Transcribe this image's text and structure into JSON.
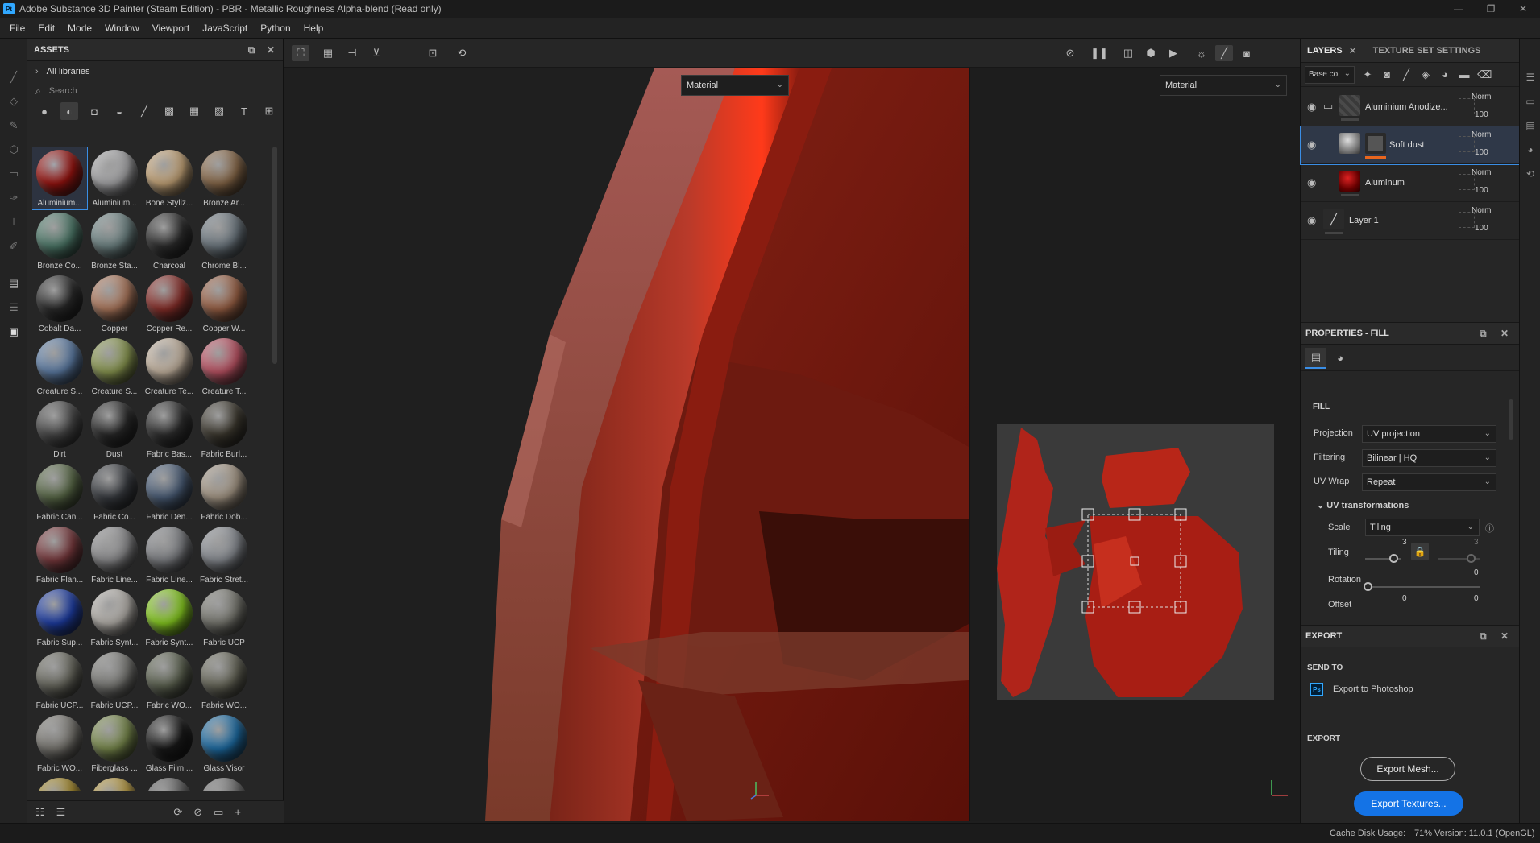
{
  "window": {
    "app_icon": "Pt",
    "title": "Adobe Substance 3D Painter (Steam Edition) - PBR - Metallic Roughness Alpha-blend (Read only)",
    "controls": [
      "—",
      "❐",
      "✕"
    ]
  },
  "menu": [
    "File",
    "Edit",
    "Mode",
    "Window",
    "Viewport",
    "JavaScript",
    "Python",
    "Help"
  ],
  "assets": {
    "title": "ASSETS",
    "library": "All libraries",
    "search_placeholder": "Search",
    "materials": [
      "Aluminium...",
      "Aluminium...",
      "Bone Styliz...",
      "Bronze Ar...",
      "Bronze Co...",
      "Bronze Sta...",
      "Charcoal",
      "Chrome Bl...",
      "Cobalt Da...",
      "Copper",
      "Copper Re...",
      "Copper W...",
      "Creature S...",
      "Creature S...",
      "Creature Te...",
      "Creature T...",
      "Dirt",
      "Dust",
      "Fabric Bas...",
      "Fabric Burl...",
      "Fabric Can...",
      "Fabric Co...",
      "Fabric Den...",
      "Fabric Dob...",
      "Fabric Flan...",
      "Fabric Line...",
      "Fabric Line...",
      "Fabric Stret...",
      "Fabric Sup...",
      "Fabric Synt...",
      "Fabric Synt...",
      "Fabric UCP",
      "Fabric UCP...",
      "Fabric UCP...",
      "Fabric WO...",
      "Fabric WO...",
      "Fabric WO...",
      "Fiberglass ...",
      "Glass Film ...",
      "Glass Visor",
      "",
      "",
      "",
      ""
    ],
    "material_colors": [
      "#9b1410",
      "#a9a9ab",
      "#c8a77a",
      "#8a6a4a",
      "#4e7a6a",
      "#6f8585",
      "#2e2e2e",
      "#6f7a82",
      "#2b2b2b",
      "#b07a5e",
      "#8a2f2a",
      "#9c6246",
      "#5f7fa8",
      "#8c9a52",
      "#c9b8a4",
      "#c05566",
      "#4a4a4a",
      "#2a2a2a",
      "#303030",
      "#3e3a30",
      "#5a6a48",
      "#3a3d42",
      "#4b5e78",
      "#a89a88",
      "#7a3a3e",
      "#8e8e90",
      "#808286",
      "#8a8e94",
      "#1f3fa8",
      "#b8b4ae",
      "#8ad021",
      "#7a7a72",
      "#6a6a60",
      "#7c7c78",
      "#5e6452",
      "#6a6a5c",
      "#7a7872",
      "#7b8c4e",
      "#1a1a1a",
      "#1e6fa8",
      "#a68a2a",
      "#b89a40",
      "#606060",
      "#707070"
    ]
  },
  "viewport": {
    "left_mode": "Material",
    "right_mode": "Material"
  },
  "layers_panel": {
    "tabs": [
      "LAYERS",
      "TEXTURE SET SETTINGS"
    ],
    "channel": "Base co",
    "layers": [
      {
        "name": "Aluminium Anodize...",
        "blend": "Norm",
        "opacity": "100"
      },
      {
        "name": "Soft dust",
        "blend": "Norm",
        "opacity": "100"
      },
      {
        "name": "Aluminum",
        "blend": "Norm",
        "opacity": "100"
      },
      {
        "name": "Layer 1",
        "blend": "Norm",
        "opacity": "100"
      }
    ]
  },
  "properties": {
    "title": "PROPERTIES - FILL",
    "section": "FILL",
    "projection_label": "Projection",
    "projection": "UV projection",
    "filtering_label": "Filtering",
    "filtering": "Bilinear | HQ",
    "uvwrap_label": "UV Wrap",
    "uvwrap": "Repeat",
    "uvtrans_label": "UV transformations",
    "scale_label": "Scale",
    "scale": "Tiling",
    "tiling_label": "Tiling",
    "tiling_value": "3",
    "tiling_value2": "3",
    "rotation_label": "Rotation",
    "rotation_value": "0",
    "offset_label": "Offset",
    "offset_x": "0",
    "offset_y": "0"
  },
  "export": {
    "title": "EXPORT",
    "send_to": "SEND TO",
    "photoshop_icon": "Ps",
    "photoshop": "Export to Photoshop",
    "section": "EXPORT",
    "mesh_button": "Export Mesh...",
    "textures_button": "Export Textures..."
  },
  "status": {
    "cache_label": "Cache Disk Usage:",
    "cache_value": "71%",
    "version": "Version: 11.0.1 (OpenGL)"
  },
  "colors": {
    "accent_blue": "#1473e6",
    "selection": "#3a8ee6",
    "mask_orange": "#e8661e"
  }
}
